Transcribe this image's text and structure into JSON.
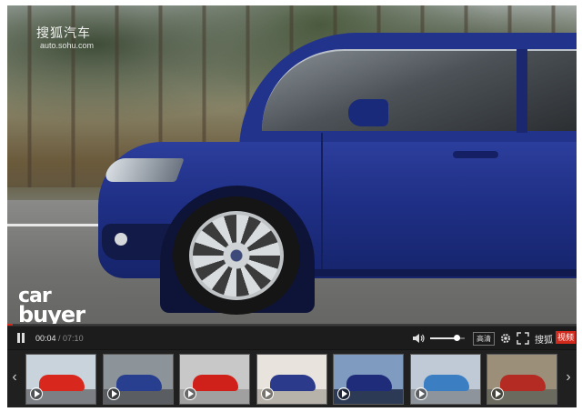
{
  "watermark": {
    "logo": "搜狐汽车",
    "url": "auto.sohu.com"
  },
  "brand": {
    "line1": "car",
    "line2": "buyer"
  },
  "controls": {
    "current_time": "00:04",
    "separator": " / ",
    "total_time": "07:10",
    "progress_fraction": 0.01,
    "volume_fraction": 0.75,
    "quality_label": "高清",
    "sohu_logo": "搜狐",
    "sohu_badge": "视频"
  },
  "colors": {
    "accent": "#d12a1d",
    "car_blue": "#22338c",
    "bar_bg": "#1c1c1c"
  },
  "icons": {
    "play_pause": "pause-icon",
    "volume": "volume-icon",
    "settings": "gear-icon",
    "fullscreen": "fullscreen-icon",
    "thumb_play": "play-icon",
    "prev": "chevron-left-icon",
    "next": "chevron-right-icon"
  },
  "nav": {
    "prev": "‹",
    "next": "›"
  },
  "thumbnails": [
    {
      "sky": "#c9d3dc",
      "ground": "#7c7f83",
      "car": "#d8281e"
    },
    {
      "sky": "#8c9499",
      "ground": "#5a5e63",
      "car": "#283e8f"
    },
    {
      "sky": "#c8c8c8",
      "ground": "#a0a0a0",
      "car": "#d0201a"
    },
    {
      "sky": "#e8e3dc",
      "ground": "#b8b3aa",
      "car": "#2b3a8a"
    },
    {
      "sky": "#7f9bbf",
      "ground": "#2d3a55",
      "car": "#1e2c7a"
    },
    {
      "sky": "#bfcad6",
      "ground": "#8d949b",
      "car": "#3b7fc2"
    },
    {
      "sky": "#9c8f7a",
      "ground": "#6b6a5f",
      "car": "#b32b22"
    }
  ]
}
